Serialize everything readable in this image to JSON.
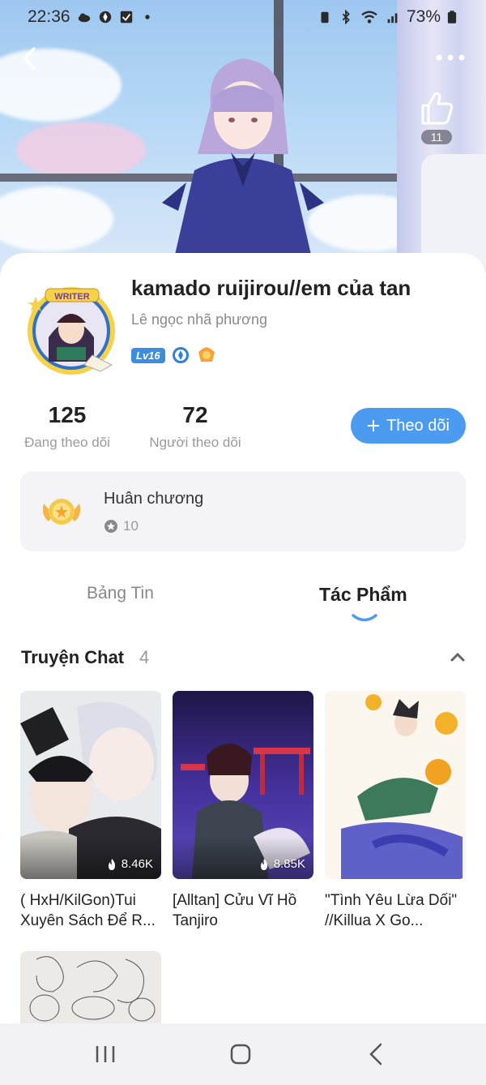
{
  "status_bar": {
    "time": "22:36",
    "battery": "73%"
  },
  "header": {
    "like_count": "11"
  },
  "profile": {
    "name": "kamado ruijirou//em của tan",
    "subname": "Lê ngọc nhã phương",
    "level_badge": "Lv16",
    "avatar_badge_text": "WRITER"
  },
  "stats": {
    "following_count": "125",
    "following_label": "Đang theo dõi",
    "followers_count": "72",
    "followers_label": "Người theo dõi"
  },
  "follow_button": {
    "icon": "plus-icon",
    "label": "Theo dõi"
  },
  "medals": {
    "title": "Huân chương",
    "count": "10"
  },
  "tabs": [
    {
      "label": "Bảng Tin",
      "active": false
    },
    {
      "label": "Tác Phẩm",
      "active": true
    }
  ],
  "section": {
    "title": "Truyện Chat",
    "count": "4"
  },
  "stories": [
    {
      "title": "( HxH/KilGon)Tui Xuyên Sách Để R...",
      "views": "8.46K"
    },
    {
      "title": "[Alltan] Cửu Vĩ Hồ Tanjiro",
      "views": "8.85K"
    },
    {
      "title": "\"Tình Yêu Lừa Dối\" //Killua X Go...",
      "views": ""
    }
  ],
  "colors": {
    "accent": "#4b9bf0",
    "card_bg": "#f4f4f6",
    "level_badge": "#3c8de0"
  }
}
